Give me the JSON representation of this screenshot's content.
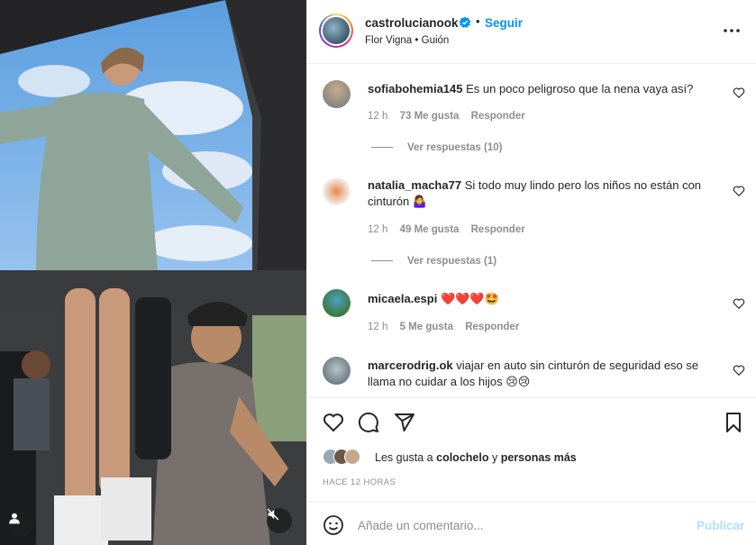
{
  "post": {
    "username": "castrolucianook",
    "follow_label": "Seguir",
    "subtitle": "Flor Vigna • Guión",
    "dot": "•"
  },
  "comments": [
    {
      "user": "sofiabohemia145",
      "text": "Es un poco peligroso que la nena vaya así?",
      "time": "12 h",
      "likes": "73 Me gusta",
      "reply": "Responder",
      "view_replies": "Ver respuestas (10)"
    },
    {
      "user": "natalia_macha77",
      "text": "Si todo muy lindo pero los niños no están con cinturón 🤷‍♀️",
      "time": "12 h",
      "likes": "49 Me gusta",
      "reply": "Responder",
      "view_replies": "Ver respuestas (1)"
    },
    {
      "user": "micaela.espi",
      "text": "❤️❤️❤️🤩",
      "time": "12 h",
      "likes": "5 Me gusta",
      "reply": "Responder"
    },
    {
      "user": "marcerodrig.ok",
      "text": "viajar en auto sin cinturón de seguridad eso se llama no cuidar a los hijos 😢😢"
    }
  ],
  "likes": {
    "prefix": "Les gusta a",
    "user": "colochelo",
    "connector": "y",
    "others": "personas más"
  },
  "timestamp": "HACE 12 HORAS",
  "add_comment": {
    "placeholder": "Añade un comentario...",
    "post_label": "Publicar"
  },
  "colors": {
    "accent": "#0095f6",
    "post_disabled": "#b2dffc",
    "muted": "#8e8e8e"
  },
  "icons": [
    "verified-icon",
    "more-icon",
    "heart-icon",
    "comment-icon",
    "share-icon",
    "bookmark-icon",
    "emoji-icon",
    "user-tag-icon",
    "mute-icon"
  ]
}
